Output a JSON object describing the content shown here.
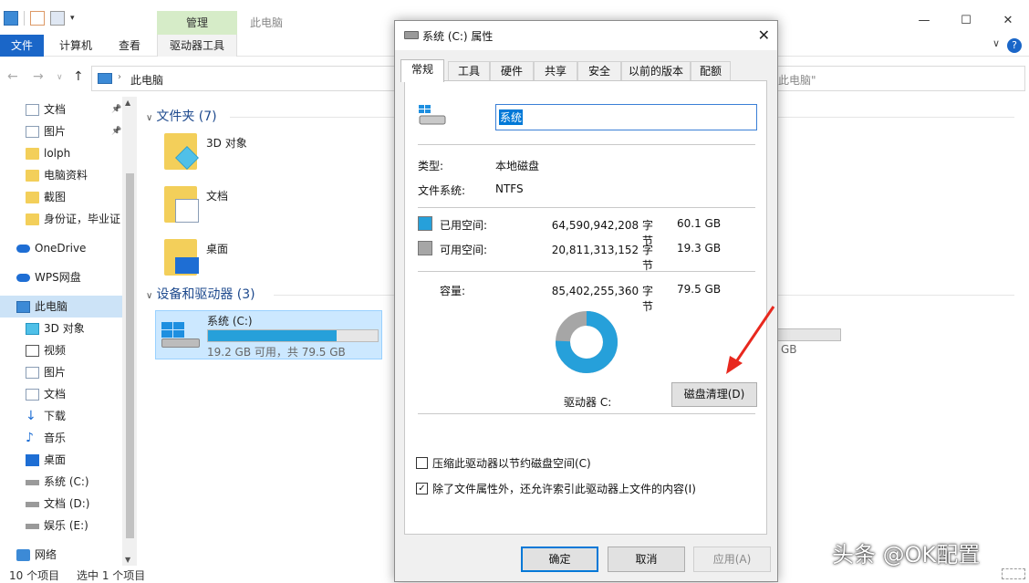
{
  "explorer": {
    "window_title": "此电脑",
    "context_tab_group": "管理",
    "ribbon_tabs": {
      "file": "文件",
      "computer": "计算机",
      "view": "查看",
      "drive_tools": "驱动器工具"
    },
    "address": {
      "crumb": "此电脑"
    },
    "search": {
      "placeholder": "此电脑\""
    },
    "sidebar": {
      "items": [
        {
          "label": "文档",
          "icon": "document-icon",
          "pinned": true
        },
        {
          "label": "图片",
          "icon": "picture-icon",
          "pinned": true
        },
        {
          "label": "lolph",
          "icon": "folder-icon"
        },
        {
          "label": "电脑资料",
          "icon": "folder-icon"
        },
        {
          "label": "截图",
          "icon": "folder-icon"
        },
        {
          "label": "身份证，毕业证",
          "icon": "folder-icon"
        },
        {
          "label": "OneDrive",
          "icon": "cloud-icon"
        },
        {
          "label": "WPS网盘",
          "icon": "cloud-icon"
        },
        {
          "label": "此电脑",
          "icon": "computer-icon",
          "selected": true
        },
        {
          "label": "3D 对象",
          "icon": "3d-objects-icon"
        },
        {
          "label": "视频",
          "icon": "video-icon"
        },
        {
          "label": "图片",
          "icon": "picture-icon"
        },
        {
          "label": "文档",
          "icon": "document-icon"
        },
        {
          "label": "下载",
          "icon": "download-icon"
        },
        {
          "label": "音乐",
          "icon": "music-icon"
        },
        {
          "label": "桌面",
          "icon": "desktop-icon"
        },
        {
          "label": "系统 (C:)",
          "icon": "drive-icon"
        },
        {
          "label": "文档 (D:)",
          "icon": "drive-icon"
        },
        {
          "label": "娱乐 (E:)",
          "icon": "drive-icon"
        },
        {
          "label": "网络",
          "icon": "network-icon"
        }
      ]
    },
    "folders_group": {
      "title": "文件夹 (7)"
    },
    "folders": [
      {
        "label": "3D 对象"
      },
      {
        "label": "文档"
      },
      {
        "label": "桌面"
      }
    ],
    "devices_group": {
      "title": "设备和驱动器 (3)"
    },
    "drive_c": {
      "name": "系统 (C:)",
      "subtitle": "19.2 GB 可用，共 79.5 GB",
      "used_fraction": 0.76
    },
    "drive_partial": {
      "subtitle": "GB"
    },
    "status": {
      "count": "10 个项目",
      "selection": "选中 1 个项目"
    }
  },
  "dialog": {
    "title": "系统 (C:) 属性",
    "tabs": [
      "常规",
      "工具",
      "硬件",
      "共享",
      "安全",
      "以前的版本",
      "配额"
    ],
    "active_tab": "常规",
    "drive_name": "系统",
    "type_label": "类型:",
    "type_value": "本地磁盘",
    "fs_label": "文件系统:",
    "fs_value": "NTFS",
    "used": {
      "label": "已用空间:",
      "bytes": "64,590,942,208 字节",
      "gb": "60.1 GB",
      "color": "#26a0da"
    },
    "free": {
      "label": "可用空间:",
      "bytes": "20,811,313,152 字节",
      "gb": "19.3 GB",
      "color": "#a6a6a6"
    },
    "capacity": {
      "label": "容量:",
      "bytes": "85,402,255,360 字节",
      "gb": "79.5 GB"
    },
    "used_fraction": 0.756,
    "drive_caption": "驱动器 C:",
    "cleanup_button": "磁盘清理(D)",
    "compress_label": "压缩此驱动器以节约磁盘空间(C)",
    "compress_checked": false,
    "index_label": "除了文件属性外，还允许索引此驱动器上文件的内容(I)",
    "index_checked": true,
    "ok_button": "确定",
    "cancel_button": "取消",
    "apply_button": "应用(A)"
  },
  "watermark": "头条 @OK配置"
}
